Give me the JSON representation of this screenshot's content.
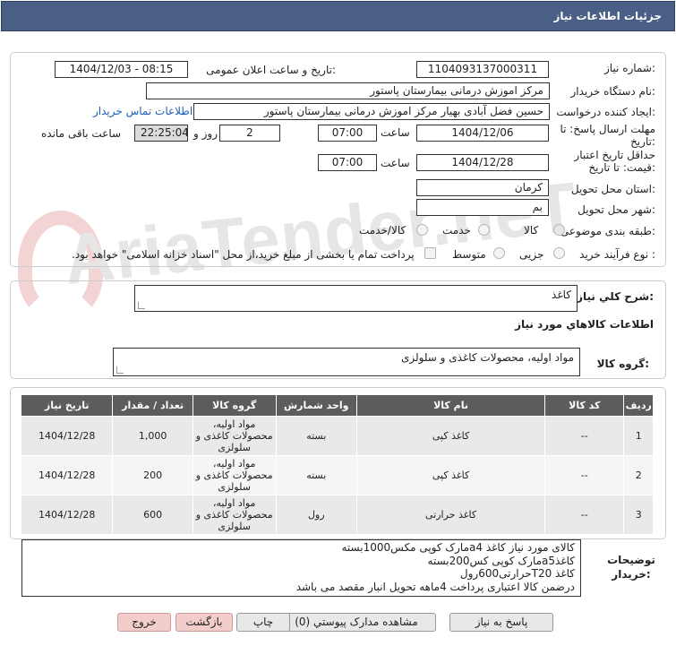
{
  "title": "جزئیات اطلاعات نیاز",
  "labels": {
    "need_number": "شماره نیاز:",
    "announce_datetime": "تاریخ و ساعت اعلان عمومی:",
    "buyer_org": "نام دستگاه خریدار:",
    "requester": "ایجاد کننده درخواست:",
    "contact_link": "اطلاعات تماس خریدار",
    "reply_deadline": "مهلت ارسال پاسخ: تا تاریخ:",
    "time": "ساعت",
    "day_and": "روز و",
    "remaining": "ساعت باقی مانده",
    "min_validity": "حداقل تاریخ اعتبار قیمت: تا تاریخ:",
    "province": "استان محل تحویل:",
    "city": "شهر محل تحویل:",
    "category": "طبقه بندی موضوعی:",
    "purchase_type": "نوع فرآیند خرید :",
    "treasury_note": "پرداخت تمام یا بخشی از مبلغ خرید،از محل \"اسناد خزانه اسلامی\" خواهد بود.",
    "general_desc": "شرح كلي نياز:",
    "goods_info": "اطلاعات كالاهاي مورد نياز",
    "goods_group": "گروه کالا:",
    "buyer_notes": "توضیحات خریدار:"
  },
  "values": {
    "need_number": "1104093137000311",
    "announce_datetime": "1404/12/03 - 08:15",
    "buyer_org": "مرکز اموزش درمانی بیمارستان پاستور",
    "requester": "حسین فضل آبادی بهیار مرکز اموزش درمانی بیمارستان پاستور",
    "reply_date": "1404/12/06",
    "reply_time": "07:00",
    "days": "2",
    "remaining_time": "22:25:04",
    "validity_date": "1404/12/28",
    "validity_time": "07:00",
    "province": "کرمان",
    "city": "بم",
    "general_desc": "کاغذ",
    "goods_group": "مواد اولیه، محصولات کاغذی و سلولزی"
  },
  "category_options": [
    "کالا",
    "خدمت",
    "کالا/خدمت"
  ],
  "purchase_options": [
    "جزیی",
    "متوسط"
  ],
  "table": {
    "headers": [
      "ردیف",
      "کد کالا",
      "نام کالا",
      "واحد شمارش",
      "گروه کالا",
      "تعداد / مقدار",
      "تاریخ نیاز"
    ],
    "rows": [
      {
        "idx": "1",
        "code": "--",
        "name": "کاغذ کپی",
        "unit": "بسته",
        "group": "مواد اولیه، محصولات کاغذی و سلولزی",
        "qty": "1,000",
        "date": "1404/12/28"
      },
      {
        "idx": "2",
        "code": "--",
        "name": "کاغذ کپی",
        "unit": "بسته",
        "group": "مواد اولیه، محصولات کاغذی و سلولزی",
        "qty": "200",
        "date": "1404/12/28"
      },
      {
        "idx": "3",
        "code": "--",
        "name": "کاغذ حرارتی",
        "unit": "رول",
        "group": "مواد اولیه، محصولات کاغذی و سلولزی",
        "qty": "600",
        "date": "1404/12/28"
      }
    ]
  },
  "notes": [
    "کالای مورد نیاز کاغذ a4مارک کوپی مکس1000بسته",
    "کاغذa5مارک کوپی کس200بسته",
    "کاغذ T20حرارتی600رول",
    "درضمن کالا اعتباری پرداخت 4ماهه تحویل انبار مقصد می باشد"
  ],
  "buttons": {
    "reply": "پاسخ به نیاز",
    "view_docs": "مشاهده مدارک پیوستي (0)",
    "print": "چاپ",
    "back": "بازگشت",
    "exit": "خروج"
  },
  "watermark": "AriaTender.neT"
}
